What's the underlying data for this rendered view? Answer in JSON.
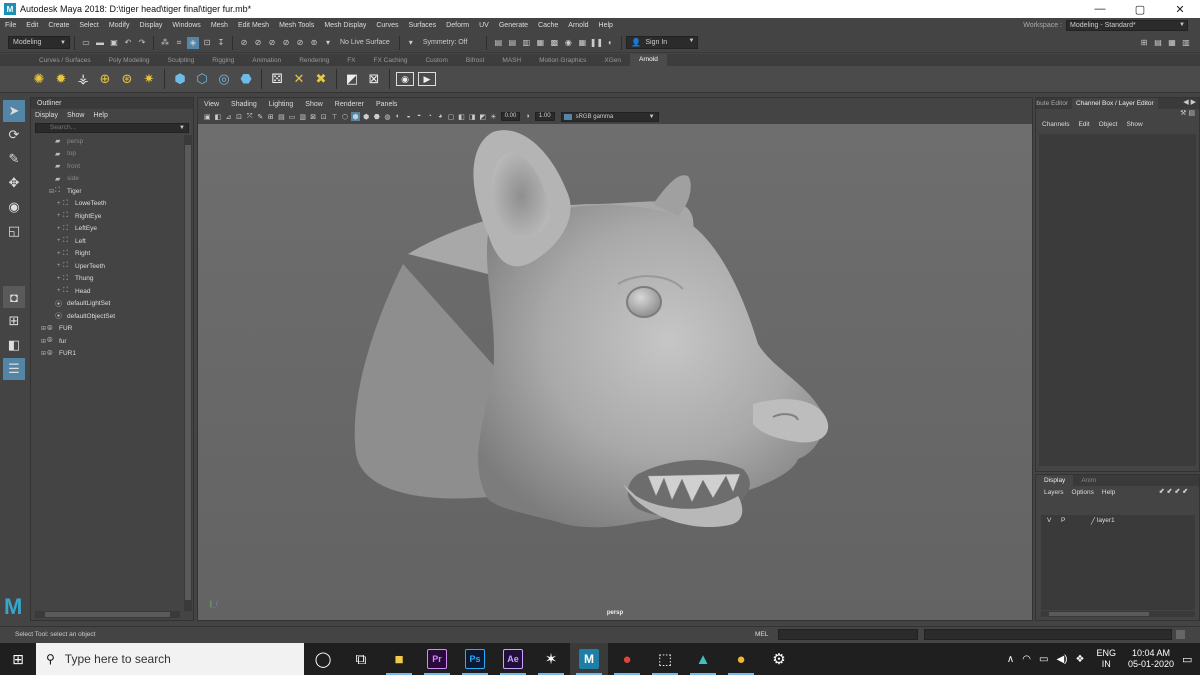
{
  "window": {
    "title": "Autodesk Maya 2018: D:\\tiger head\\tiger final\\tiger fur.mb*",
    "app_icon": "M",
    "minimize": "—",
    "maximize": "▢",
    "close": "✕"
  },
  "menubar": {
    "items": [
      "File",
      "Edit",
      "Create",
      "Select",
      "Modify",
      "Display",
      "Windows",
      "Mesh",
      "Edit Mesh",
      "Mesh Tools",
      "Mesh Display",
      "Curves",
      "Surfaces",
      "Deform",
      "UV",
      "Generate",
      "Cache",
      "Arnold",
      "Help"
    ],
    "workspace_label": "Workspace :",
    "workspace_value": "Modeling - Standard*"
  },
  "statusline": {
    "mode": "Modeling",
    "live_surface": "No Live Surface",
    "symmetry": "Symmetry: Off",
    "sign_in": "Sign In"
  },
  "shelf": {
    "tabs": [
      "Curves / Surfaces",
      "Poly Modeling",
      "Sculpting",
      "Rigging",
      "Animation",
      "Rendering",
      "FX",
      "FX Caching",
      "Custom",
      "Bifrost",
      "MASH",
      "Motion Graphics",
      "XGen",
      "Arnold"
    ],
    "active_tab": "Arnold"
  },
  "outliner": {
    "title": "Outliner",
    "menu": [
      "Display",
      "Show",
      "Help"
    ],
    "search_placeholder": "Search...",
    "items": [
      {
        "label": "persp",
        "depth": 1,
        "dim": true,
        "icon": "camera"
      },
      {
        "label": "top",
        "depth": 1,
        "dim": true,
        "icon": "camera"
      },
      {
        "label": "front",
        "depth": 1,
        "dim": true,
        "icon": "camera"
      },
      {
        "label": "side",
        "depth": 1,
        "dim": true,
        "icon": "camera"
      },
      {
        "label": "Tiger",
        "depth": 1,
        "dim": false,
        "icon": "group",
        "expander": "⊟"
      },
      {
        "label": "LoweTeeth",
        "depth": 2,
        "dim": false,
        "icon": "mesh",
        "expander": "+"
      },
      {
        "label": "RightEye",
        "depth": 2,
        "dim": false,
        "icon": "mesh",
        "expander": "+"
      },
      {
        "label": "LeftEye",
        "depth": 2,
        "dim": false,
        "icon": "mesh",
        "expander": "+"
      },
      {
        "label": "Left",
        "depth": 2,
        "dim": false,
        "icon": "mesh",
        "expander": "+"
      },
      {
        "label": "Right",
        "depth": 2,
        "dim": false,
        "icon": "mesh",
        "expander": "+"
      },
      {
        "label": "UperTeeth",
        "depth": 2,
        "dim": false,
        "icon": "mesh",
        "expander": "+"
      },
      {
        "label": "Thung",
        "depth": 2,
        "dim": false,
        "icon": "mesh",
        "expander": "+"
      },
      {
        "label": "Head",
        "depth": 2,
        "dim": false,
        "icon": "mesh",
        "expander": "+"
      },
      {
        "label": "defaultLightSet",
        "depth": 1,
        "dim": false,
        "icon": "set"
      },
      {
        "label": "defaultObjectSet",
        "depth": 1,
        "dim": false,
        "icon": "set"
      },
      {
        "label": "FUR",
        "depth": 0,
        "dim": false,
        "icon": "fur",
        "expander": "⊞"
      },
      {
        "label": "fur",
        "depth": 0,
        "dim": false,
        "icon": "fur",
        "expander": "⊞"
      },
      {
        "label": "FUR1",
        "depth": 0,
        "dim": false,
        "icon": "fur",
        "expander": "⊞"
      }
    ]
  },
  "viewport": {
    "menu": [
      "View",
      "Shading",
      "Lighting",
      "Show",
      "Renderer",
      "Panels"
    ],
    "exposure": "0.00",
    "gamma": "1.00",
    "color_space": "sRGB gamma",
    "camera": "persp"
  },
  "channelbox": {
    "tabs": [
      "Attribute Editor",
      "Channel Box / Layer Editor"
    ],
    "active_tab": "Channel Box / Layer Editor",
    "menu": [
      "Channels",
      "Edit",
      "Object",
      "Show"
    ]
  },
  "layereditor": {
    "tabs": [
      "Display",
      "Anim"
    ],
    "active_tab": "Display",
    "menu": [
      "Layers",
      "Options",
      "Help"
    ],
    "layers": [
      {
        "v": "V",
        "p": "P",
        "name": "layer1"
      }
    ]
  },
  "helpline": {
    "text": "Select Tool: select an object",
    "mel_label": "MEL"
  },
  "taskbar": {
    "search_placeholder": "Type here to search",
    "apps": [
      {
        "name": "Cortana",
        "glyph": "◯"
      },
      {
        "name": "Task View",
        "glyph": "⧉"
      },
      {
        "name": "File Explorer",
        "glyph": "■"
      },
      {
        "name": "Premiere Pro",
        "glyph": "Pr"
      },
      {
        "name": "Photoshop",
        "glyph": "Ps"
      },
      {
        "name": "After Effects",
        "glyph": "Ae"
      },
      {
        "name": "Zbrush",
        "glyph": "✶"
      },
      {
        "name": "Maya",
        "glyph": "M"
      },
      {
        "name": "Chrome",
        "glyph": "●"
      },
      {
        "name": "Recorder",
        "glyph": "⬚"
      },
      {
        "name": "Mudbox",
        "glyph": "▲"
      },
      {
        "name": "Chrome 2",
        "glyph": "●"
      },
      {
        "name": "Settings",
        "glyph": "⚙"
      }
    ],
    "lang_top": "ENG",
    "lang_bottom": "IN",
    "time": "10:04 AM",
    "date": "05-01-2020"
  },
  "colors": {
    "accent": "#5285a6",
    "maya_blue": "#37a6c8",
    "panel": "#444444",
    "viewport_bg": "#6a6a6a"
  }
}
